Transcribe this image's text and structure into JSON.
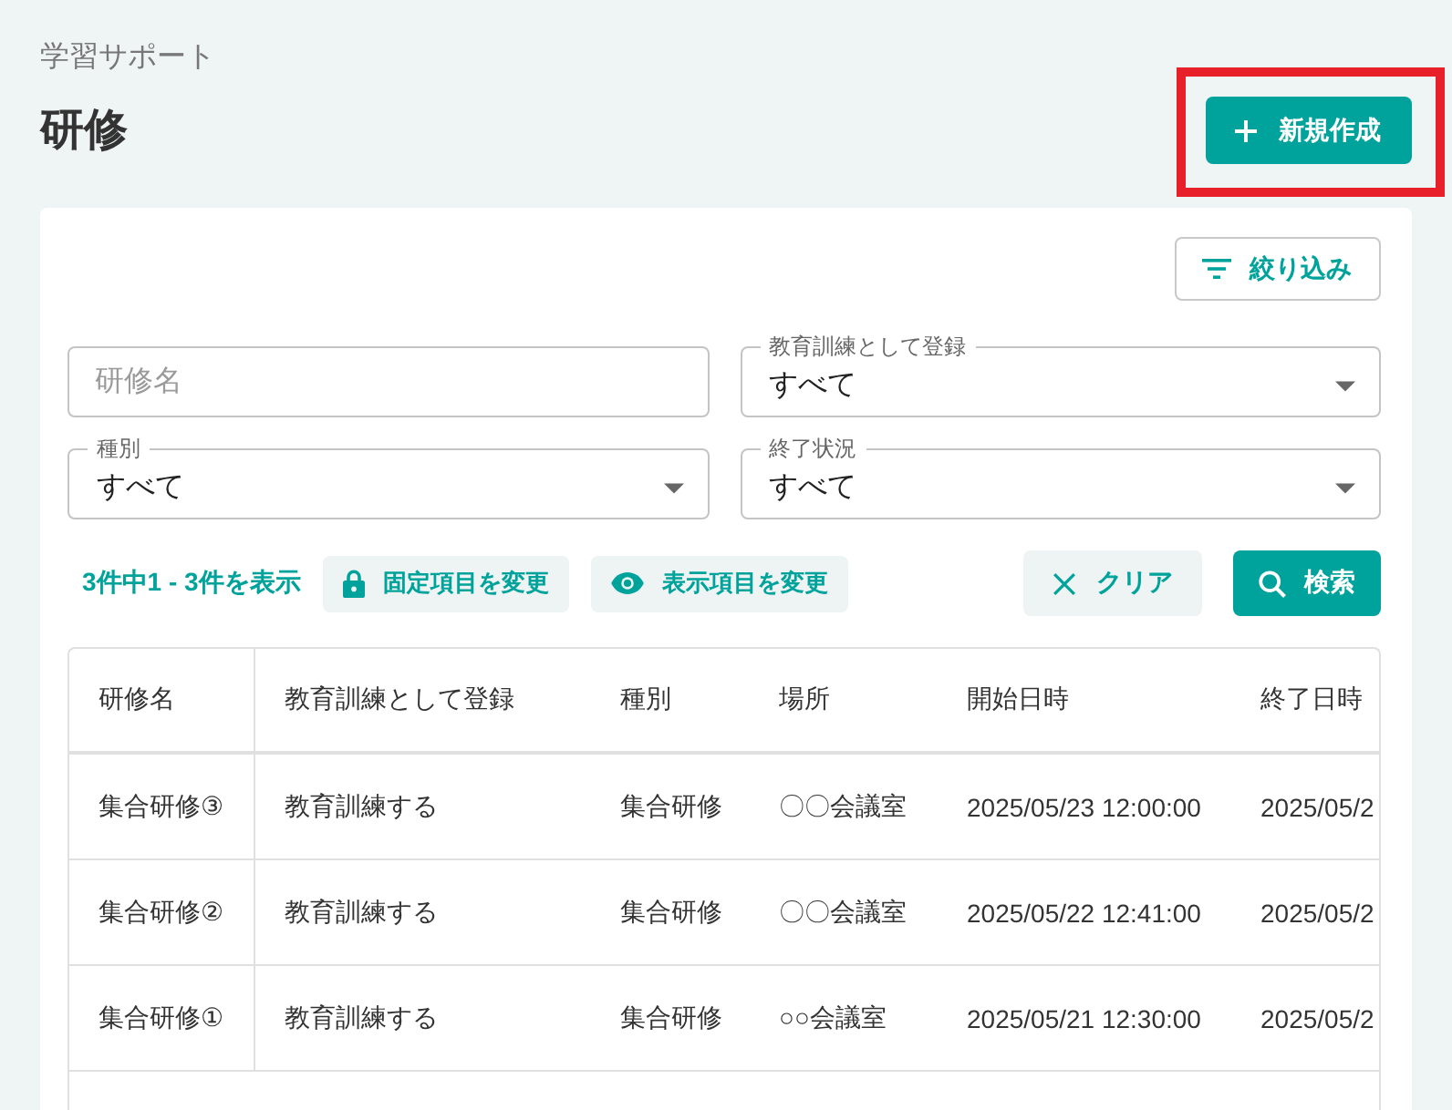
{
  "breadcrumb": "学習サポート",
  "title": "研修",
  "create_button": {
    "label": "新規作成",
    "highlighted": true
  },
  "filter_toggle": {
    "label": "絞り込み"
  },
  "filter_rows": [
    [
      {
        "kind": "text",
        "placeholder": "研修名"
      },
      {
        "kind": "select",
        "label": "教育訓練として登録",
        "value": "すべて"
      }
    ],
    [
      {
        "kind": "select",
        "label": "種別",
        "value": "すべて"
      },
      {
        "kind": "select",
        "label": "終了状況",
        "value": "すべて"
      }
    ]
  ],
  "result_count": "3件中1 - 3件を表示",
  "fixed_columns_button": {
    "label": "固定項目を変更"
  },
  "visible_columns_button": {
    "label": "表示項目を変更"
  },
  "clear_button": {
    "label": "クリア"
  },
  "search_button": {
    "label": "検索"
  },
  "table": {
    "columns": [
      {
        "label": "研修名",
        "fixed": true
      },
      {
        "label": "教育訓練として登録",
        "fixed": false
      },
      {
        "label": "種別",
        "fixed": false
      },
      {
        "label": "場所",
        "fixed": false
      },
      {
        "label": "開始日時",
        "fixed": false
      },
      {
        "label": "終了日時",
        "fixed": false
      }
    ],
    "rows": [
      [
        "集合研修③",
        "教育訓練する",
        "集合研修",
        "〇〇会議室",
        "2025/05/23 12:00:00",
        "2025/05/2"
      ],
      [
        "集合研修②",
        "教育訓練する",
        "集合研修",
        "〇〇会議室",
        "2025/05/22 12:41:00",
        "2025/05/2"
      ],
      [
        "集合研修①",
        "教育訓練する",
        "集合研修",
        "○○会議室",
        "2025/05/21 12:30:00",
        "2025/05/2"
      ]
    ]
  }
}
